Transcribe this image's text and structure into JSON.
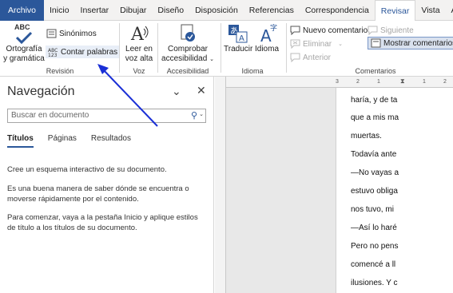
{
  "menu": {
    "tabs": [
      "Archivo",
      "Inicio",
      "Insertar",
      "Dibujar",
      "Diseño",
      "Disposición",
      "Referencias",
      "Correspondencia",
      "Revisar",
      "Vista",
      "Ayuda"
    ],
    "active_tab": "Revisar"
  },
  "ribbon": {
    "revision": {
      "spelling_line1": "Ortografía",
      "spelling_line2": "y gramática",
      "synonyms": "Sinónimos",
      "word_count": "Contar palabras",
      "label": "Revisión"
    },
    "voice": {
      "read_line1": "Leer en",
      "read_line2": "voz alta",
      "label": "Voz"
    },
    "accessibility": {
      "check_line1": "Comprobar",
      "check_line2": "accesibilidad",
      "label": "Accesibilidad"
    },
    "language": {
      "translate": "Traducir",
      "language": "Idioma",
      "label": "Idioma"
    },
    "comments": {
      "new": "Nuevo comentario",
      "delete": "Eliminar",
      "previous": "Anterior",
      "next": "Siguiente",
      "show": "Mostrar comentarios",
      "label": "Comentarios"
    },
    "icon_abc": "ABC"
  },
  "navigation": {
    "title": "Navegación",
    "search_placeholder": "Buscar en documento",
    "tabs": [
      "Títulos",
      "Páginas",
      "Resultados"
    ],
    "text1": "Cree un esquema interactivo de su documento.",
    "text2": "Es una buena manera de saber dónde se encuentra o moverse rápidamente por el contenido.",
    "text3": "Para comenzar, vaya a la pestaña Inicio y aplique estilos de título a los títulos de su documento."
  },
  "ruler": {
    "marks": [
      "3",
      "2",
      "1",
      "1",
      "2"
    ]
  },
  "document": {
    "lines": [
      "haría, y de ta",
      "que a mis ma",
      "muertas.",
      "Todavía ante",
      "—No vayas a",
      "estuvo obliga",
      "nos tuvo, mi",
      "—Así lo haré",
      "Pero no pens",
      "comencé a ll",
      "ilusiones. Y c"
    ]
  },
  "colors": {
    "accent": "#2b579a",
    "annotation_arrow": "#1a2fd6"
  }
}
